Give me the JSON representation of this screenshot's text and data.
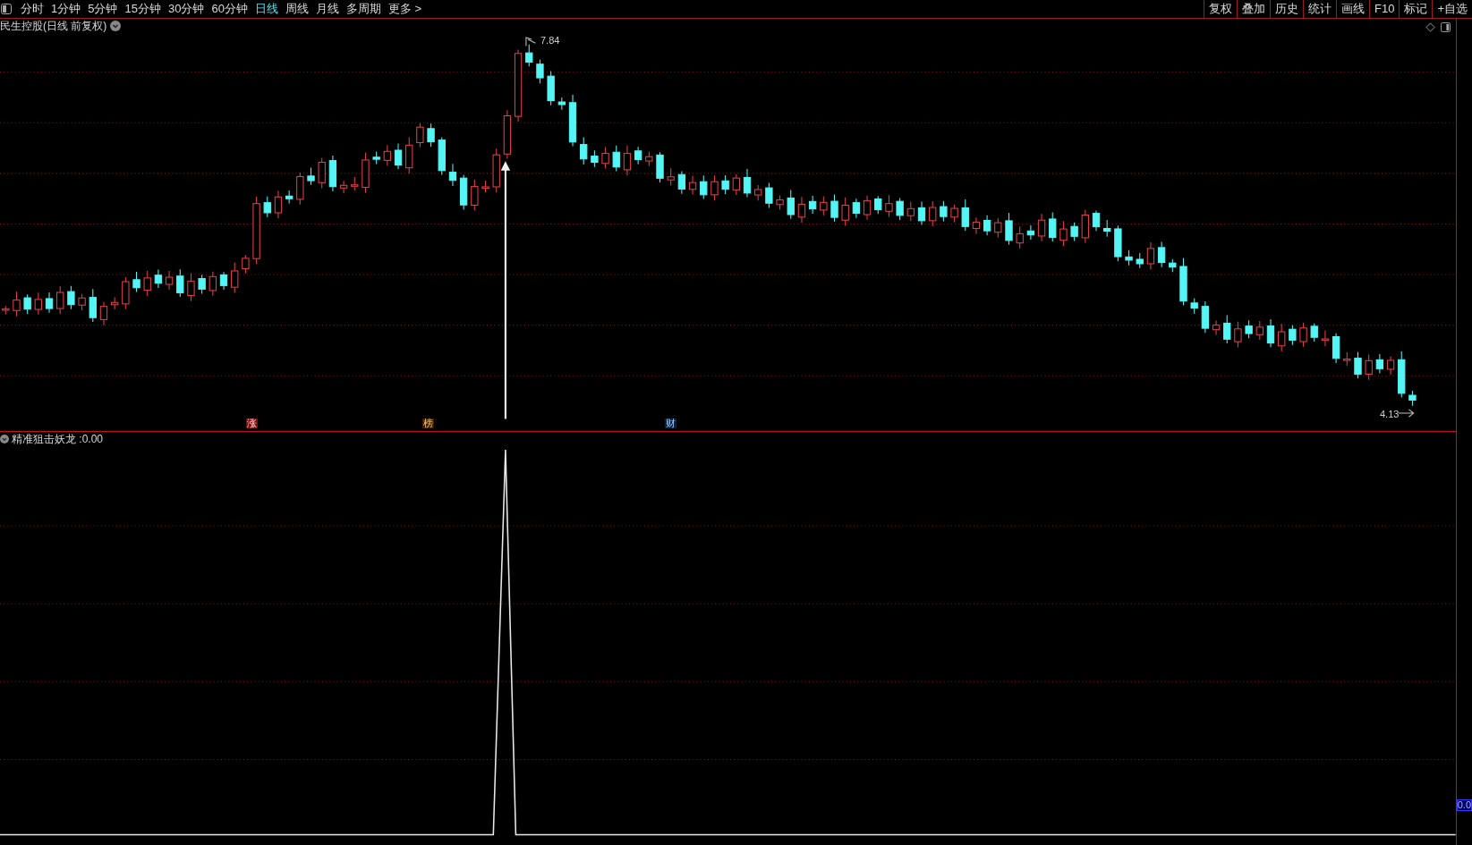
{
  "toolbar": {
    "periods": [
      {
        "label": "分时",
        "selected": false
      },
      {
        "label": "1分钟",
        "selected": false
      },
      {
        "label": "5分钟",
        "selected": false
      },
      {
        "label": "15分钟",
        "selected": false
      },
      {
        "label": "30分钟",
        "selected": false
      },
      {
        "label": "60分钟",
        "selected": false
      },
      {
        "label": "日线",
        "selected": true
      },
      {
        "label": "周线",
        "selected": false
      },
      {
        "label": "月线",
        "selected": false
      },
      {
        "label": "多周期",
        "selected": false
      },
      {
        "label": "更多 >",
        "selected": false
      }
    ],
    "actions": [
      "复权",
      "叠加",
      "历史",
      "统计",
      "画线",
      "F10",
      "标记",
      "+自选"
    ]
  },
  "main_chart": {
    "title": "民生控股(日线 前复权)",
    "high_label": "7.84",
    "low_label": "4.13",
    "markers": [
      {
        "text": "涨",
        "kind": "limit"
      },
      {
        "text": "榜",
        "kind": "ranking"
      },
      {
        "text": "财",
        "kind": "finance"
      }
    ]
  },
  "indicator": {
    "title": "精准狙击妖龙 :0.00"
  },
  "axis_value": "0.0"
}
